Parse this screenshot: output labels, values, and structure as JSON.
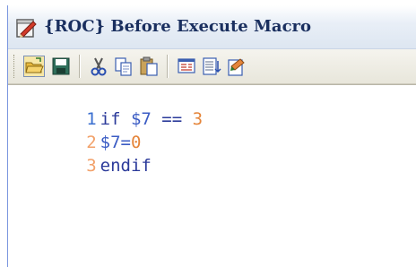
{
  "window": {
    "title": "{ROC} Before Execute Macro",
    "icon": "notepad-icon"
  },
  "toolbar": {
    "buttons": [
      {
        "name": "open-folder-icon"
      },
      {
        "name": "save-icon"
      },
      {
        "name": "cut-icon"
      },
      {
        "name": "copy-icon"
      },
      {
        "name": "paste-icon"
      },
      {
        "name": "insert-variable-icon"
      },
      {
        "name": "insert-function-icon"
      },
      {
        "name": "run-macro-icon"
      }
    ]
  },
  "editor": {
    "lines": [
      {
        "number": "1",
        "tokens": [
          {
            "text": "if ",
            "type": "kw"
          },
          {
            "text": "$7 ",
            "type": "var"
          },
          {
            "text": "== ",
            "type": "kw"
          },
          {
            "text": "3",
            "type": "num"
          }
        ]
      },
      {
        "number": "2",
        "tokens": [
          {
            "text": "$7",
            "type": "var"
          },
          {
            "text": "=",
            "type": "plain"
          },
          {
            "text": "0",
            "type": "num"
          }
        ]
      },
      {
        "number": "3",
        "tokens": [
          {
            "text": "endif",
            "type": "kw"
          }
        ]
      }
    ]
  },
  "colors": {
    "keyword": "#2B3A9A",
    "variable": "#3B5CC4",
    "number": "#E5853A",
    "line_number": "#F2A16A"
  }
}
